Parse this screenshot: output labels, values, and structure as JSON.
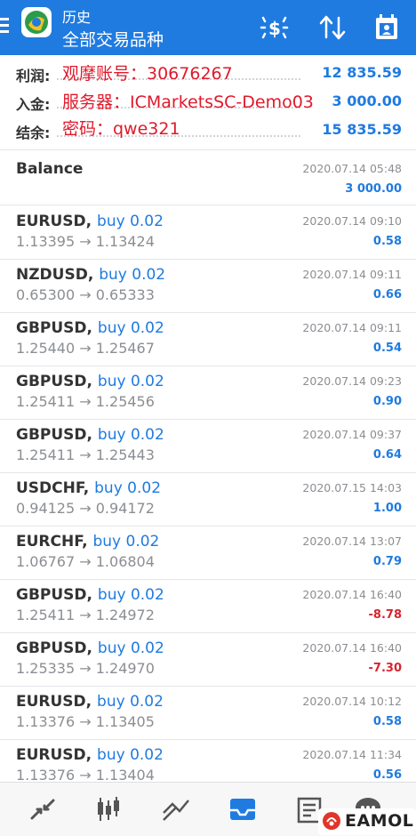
{
  "header": {
    "title": "历史",
    "subtitle": "全部交易品种"
  },
  "summary": {
    "rows": [
      {
        "label": "利润:",
        "value": "12 835.59"
      },
      {
        "label": "入金:",
        "value": "3 000.00"
      },
      {
        "label": "结余:",
        "value": "15 835.59"
      }
    ]
  },
  "overlay": {
    "line1": "观摩账号：30676267",
    "line2": "服务器：ICMarketsSC-Demo03",
    "line3": "密码：qwe321"
  },
  "balance": {
    "label": "Balance",
    "time": "2020.07.14 05:48",
    "amount": "3 000.00"
  },
  "deals": [
    {
      "symbol": "EURUSD,",
      "type": "buy 0.02",
      "prices": "1.13395 → 1.13424",
      "time": "2020.07.14 09:10",
      "profit": "0.58",
      "sign": "pos"
    },
    {
      "symbol": "NZDUSD,",
      "type": "buy 0.02",
      "prices": "0.65300 → 0.65333",
      "time": "2020.07.14 09:11",
      "profit": "0.66",
      "sign": "pos"
    },
    {
      "symbol": "GBPUSD,",
      "type": "buy 0.02",
      "prices": "1.25440 → 1.25467",
      "time": "2020.07.14 09:11",
      "profit": "0.54",
      "sign": "pos"
    },
    {
      "symbol": "GBPUSD,",
      "type": "buy 0.02",
      "prices": "1.25411 → 1.25456",
      "time": "2020.07.14 09:23",
      "profit": "0.90",
      "sign": "pos"
    },
    {
      "symbol": "GBPUSD,",
      "type": "buy 0.02",
      "prices": "1.25411 → 1.25443",
      "time": "2020.07.14 09:37",
      "profit": "0.64",
      "sign": "pos"
    },
    {
      "symbol": "USDCHF,",
      "type": "buy 0.02",
      "prices": "0.94125 → 0.94172",
      "time": "2020.07.15 14:03",
      "profit": "1.00",
      "sign": "pos"
    },
    {
      "symbol": "EURCHF,",
      "type": "buy 0.02",
      "prices": "1.06767 → 1.06804",
      "time": "2020.07.14 13:07",
      "profit": "0.79",
      "sign": "pos"
    },
    {
      "symbol": "GBPUSD,",
      "type": "buy 0.02",
      "prices": "1.25411 → 1.24972",
      "time": "2020.07.14 16:40",
      "profit": "-8.78",
      "sign": "neg"
    },
    {
      "symbol": "GBPUSD,",
      "type": "buy 0.02",
      "prices": "1.25335 → 1.24970",
      "time": "2020.07.14 16:40",
      "profit": "-7.30",
      "sign": "neg"
    },
    {
      "symbol": "EURUSD,",
      "type": "buy 0.02",
      "prices": "1.13376 → 1.13405",
      "time": "2020.07.14 10:12",
      "profit": "0.58",
      "sign": "pos"
    },
    {
      "symbol": "EURUSD,",
      "type": "buy 0.02",
      "prices": "1.13376 → 1.13404",
      "time": "2020.07.14 11:34",
      "profit": "0.56",
      "sign": "pos"
    }
  ],
  "bottom_nav": {
    "items": [
      "quotes-icon",
      "chart-icon",
      "trade-icon",
      "history-icon",
      "news-icon",
      "chat-icon"
    ],
    "active_index": 3
  },
  "watermark": {
    "text": "EAMOL"
  },
  "colors": {
    "accent": "#1f7be0",
    "negative": "#d8242f",
    "overlay_text": "#e0192b",
    "muted": "#8b8e92"
  }
}
